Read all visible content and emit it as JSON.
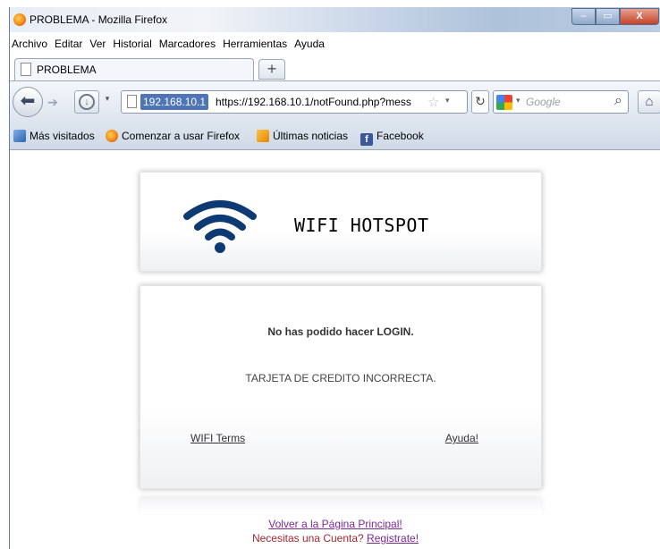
{
  "window": {
    "title": "PROBLEMA - Mozilla Firefox",
    "buttons": {
      "minimize": "–",
      "maximize": "▭",
      "close": "X"
    }
  },
  "menubar": [
    "Archivo",
    "Editar",
    "Ver",
    "Historial",
    "Marcadores",
    "Herramientas",
    "Ayuda"
  ],
  "tabs": [
    {
      "title": "PROBLEMA"
    }
  ],
  "newtab_label": "+",
  "navbar": {
    "url_ip": "192.168.10.1",
    "url": "https://192.168.10.1/notFound.php?mess",
    "search_placeholder": "Google"
  },
  "bookmarks": [
    {
      "label": "Más visitados",
      "icon": "most-visited-icon"
    },
    {
      "label": "Comenzar a usar Firefox",
      "icon": "firefox-icon"
    },
    {
      "label": "Últimas noticias",
      "icon": "rss-icon"
    },
    {
      "label": "Facebook",
      "icon": "facebook-icon"
    }
  ],
  "page": {
    "header_title": "WIFI HOTSPOT",
    "message_title": "No has podido hacer LOGIN.",
    "message_text": "TARJETA DE CREDITO INCORRECTA.",
    "link_terms": "WIFI Terms",
    "link_help": "Ayuda!",
    "back_home": "Volver a la Página Principal!",
    "need_account": "Necesitas una Cuenta?",
    "register": "Registrate!"
  },
  "colors": {
    "wifi_logo": "#0d3a73",
    "link_visited": "#7b2a8f",
    "signup_text": "#a4282f",
    "url_ip_highlight": "#4f74b7"
  }
}
